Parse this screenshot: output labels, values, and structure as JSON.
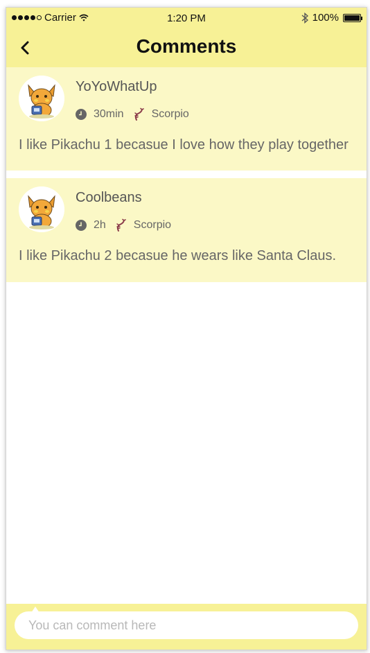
{
  "status_bar": {
    "carrier": "Carrier",
    "time": "1:20 PM",
    "battery": "100%"
  },
  "nav": {
    "title": "Comments",
    "back_icon": "chevron-left-icon"
  },
  "comments": [
    {
      "username": "YoYoWhatUp",
      "time_ago": "30min",
      "sign": "Scorpio",
      "text": "I like Pikachu 1 becasue I love how they play together"
    },
    {
      "username": "Coolbeans",
      "time_ago": "2h",
      "sign": "Scorpio",
      "text": "I like Pikachu 2 becasue he wears like Santa Claus."
    }
  ],
  "composer": {
    "placeholder": "You can comment here"
  },
  "colors": {
    "bar_yellow": "#f7f196",
    "card_yellow": "#fbf8c6"
  }
}
